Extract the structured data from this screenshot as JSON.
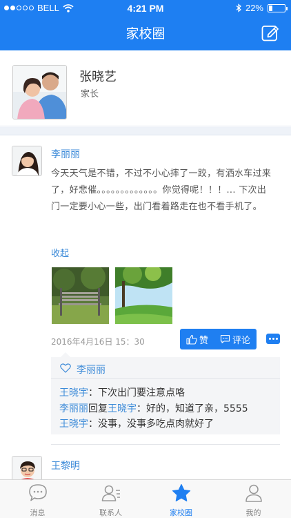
{
  "status_bar": {
    "carrier": "BELL",
    "time": "4:21 PM",
    "battery": "22%"
  },
  "header": {
    "title": "家校圈",
    "edit_icon": "compose-icon"
  },
  "profile": {
    "name": "张晓艺",
    "role": "家长"
  },
  "post": {
    "author": "李丽丽",
    "content": "今天天气是不错，不过不小心摔了一跤，有洒水车过来了，好悲催。。。。。。。。。。。。。你觉得呢！！！... 下次出门一定要小心一些，出门看着路走在也不看手机了。",
    "collapse_label": "收起",
    "timestamp": "2016年4月16日  15：30",
    "like_label": "赞",
    "comment_label": "评论",
    "liked_by": "李丽丽",
    "comments": [
      {
        "user": "王晓宇",
        "reply_word": "",
        "reply_to": "",
        "text": "：下次出门要注意点咯"
      },
      {
        "user": "李丽丽",
        "reply_word": "回复",
        "reply_to": "王晓宇",
        "text": "：好的，知道了亲，5555"
      },
      {
        "user": "王晓宇",
        "reply_word": "",
        "reply_to": "",
        "text": "：没事，没事多吃点肉就好了"
      }
    ]
  },
  "post2": {
    "author": "王黎明"
  },
  "tabbar": [
    {
      "label": "消息",
      "icon": "chat-bubble-icon",
      "active": false
    },
    {
      "label": "联系人",
      "icon": "contacts-icon",
      "active": false
    },
    {
      "label": "家校圈",
      "icon": "star-icon",
      "active": true
    },
    {
      "label": "我的",
      "icon": "person-icon",
      "active": false
    }
  ],
  "colors": {
    "primary": "#1e7ff2",
    "link": "#3b8ad8",
    "background": "#eef2f8"
  }
}
